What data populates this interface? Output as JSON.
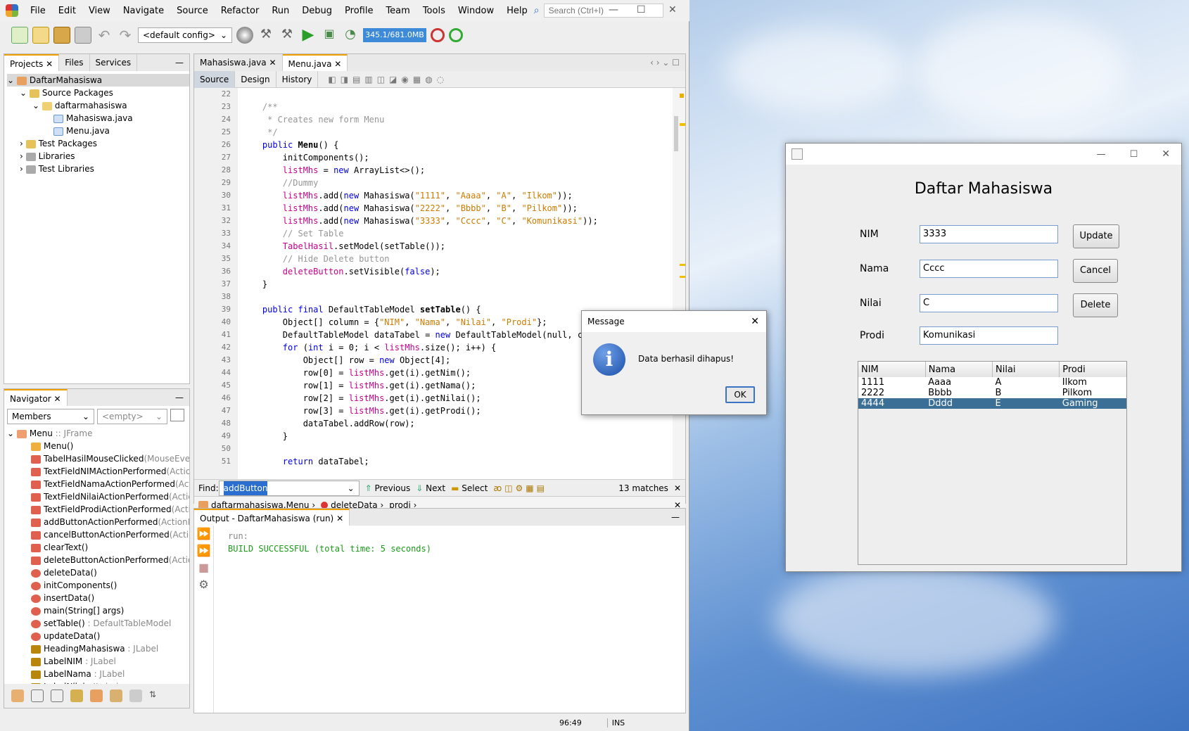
{
  "menubar": {
    "items": [
      "File",
      "Edit",
      "View",
      "Navigate",
      "Source",
      "Refactor",
      "Run",
      "Debug",
      "Profile",
      "Team",
      "Tools",
      "Window",
      "Help"
    ],
    "search_placeholder": "Search (Ctrl+I)"
  },
  "toolbar": {
    "config": "<default config>",
    "memory": "345.1/681.0MB"
  },
  "projects": {
    "tabs": [
      "Projects",
      "Files",
      "Services"
    ],
    "tree": [
      "DaftarMahasiswa",
      "Source Packages",
      "daftarmahasiswa",
      "Mahasiswa.java",
      "Menu.java",
      "Test Packages",
      "Libraries",
      "Test Libraries"
    ]
  },
  "navigator": {
    "title": "Navigator",
    "filter": "Members",
    "empty": "<empty>",
    "root": "Menu",
    "root_type": " :: JFrame",
    "items": [
      {
        "name": "Menu()",
        "type": ""
      },
      {
        "name": "TabelHasilMouseClicked",
        "type": "(MouseEver"
      },
      {
        "name": "TextFieldNIMActionPerformed",
        "type": "(Actio"
      },
      {
        "name": "TextFieldNamaActionPerformed",
        "type": "(Act"
      },
      {
        "name": "TextFieldNilaiActionPerformed",
        "type": "(Actic"
      },
      {
        "name": "TextFieldProdiActionPerformed",
        "type": "(Acti"
      },
      {
        "name": "addButtonActionPerformed",
        "type": "(ActionE"
      },
      {
        "name": "cancelButtonActionPerformed",
        "type": "(Actio"
      },
      {
        "name": "clearText()",
        "type": ""
      },
      {
        "name": "deleteButtonActionPerformed",
        "type": "(Actio"
      },
      {
        "name": "deleteData()",
        "type": ""
      },
      {
        "name": "initComponents()",
        "type": ""
      },
      {
        "name": "insertData()",
        "type": ""
      },
      {
        "name": "main(String[] args)",
        "type": ""
      },
      {
        "name": "setTable()",
        "type": " : DefaultTableModel"
      },
      {
        "name": "updateData()",
        "type": ""
      },
      {
        "name": "HeadingMahasiswa",
        "type": " : JLabel"
      },
      {
        "name": "LabelNIM",
        "type": " : JLabel"
      },
      {
        "name": "LabelNama",
        "type": " : JLabel"
      },
      {
        "name": "LabelNilai",
        "type": " : JLabel"
      }
    ]
  },
  "editor": {
    "tabs": [
      "Mahasiswa.java",
      "Menu.java"
    ],
    "subtabs": [
      "Source",
      "Design",
      "History"
    ],
    "line_numbers": [
      "22",
      "23",
      "24",
      "25",
      "26",
      "27",
      "28",
      "29",
      "30",
      "31",
      "32",
      "33",
      "34",
      "35",
      "36",
      "37",
      "38",
      "39",
      "40",
      "41",
      "42",
      "43",
      "44",
      "45",
      "46",
      "47",
      "48",
      "49",
      "50",
      "51"
    ]
  },
  "find": {
    "label": "Find:",
    "value": "addButton",
    "previous": "Previous",
    "next": "Next",
    "select": "Select",
    "matches": "13 matches"
  },
  "breadcrumb": {
    "items": [
      "daftarmahasiswa.Menu",
      "deleteData",
      "prodi"
    ]
  },
  "output": {
    "title": "Output - DaftarMahasiswa (run)",
    "line1": "run:",
    "line2": "BUILD SUCCESSFUL (total time: 5 seconds)"
  },
  "status": {
    "position": "96:49",
    "mode": "INS"
  },
  "message": {
    "title": "Message",
    "text": "Data berhasil dihapus!",
    "ok": "OK"
  },
  "app": {
    "title": "Daftar Mahasiswa",
    "labels": {
      "nim": "NIM",
      "nama": "Nama",
      "nilai": "Nilai",
      "prodi": "Prodi"
    },
    "values": {
      "nim": "3333",
      "nama": "Cccc",
      "nilai": "C",
      "prodi": "Komunikasi"
    },
    "buttons": {
      "update": "Update",
      "cancel": "Cancel",
      "delete": "Delete"
    },
    "columns": [
      "NIM",
      "Nama",
      "Nilai",
      "Prodi"
    ],
    "rows": [
      [
        "1111",
        "Aaaa",
        "A",
        "Ilkom"
      ],
      [
        "2222",
        "Bbbb",
        "B",
        "Pilkom"
      ],
      [
        "4444",
        "Dddd",
        "E",
        "Gaming"
      ]
    ],
    "selected_row": 2
  }
}
